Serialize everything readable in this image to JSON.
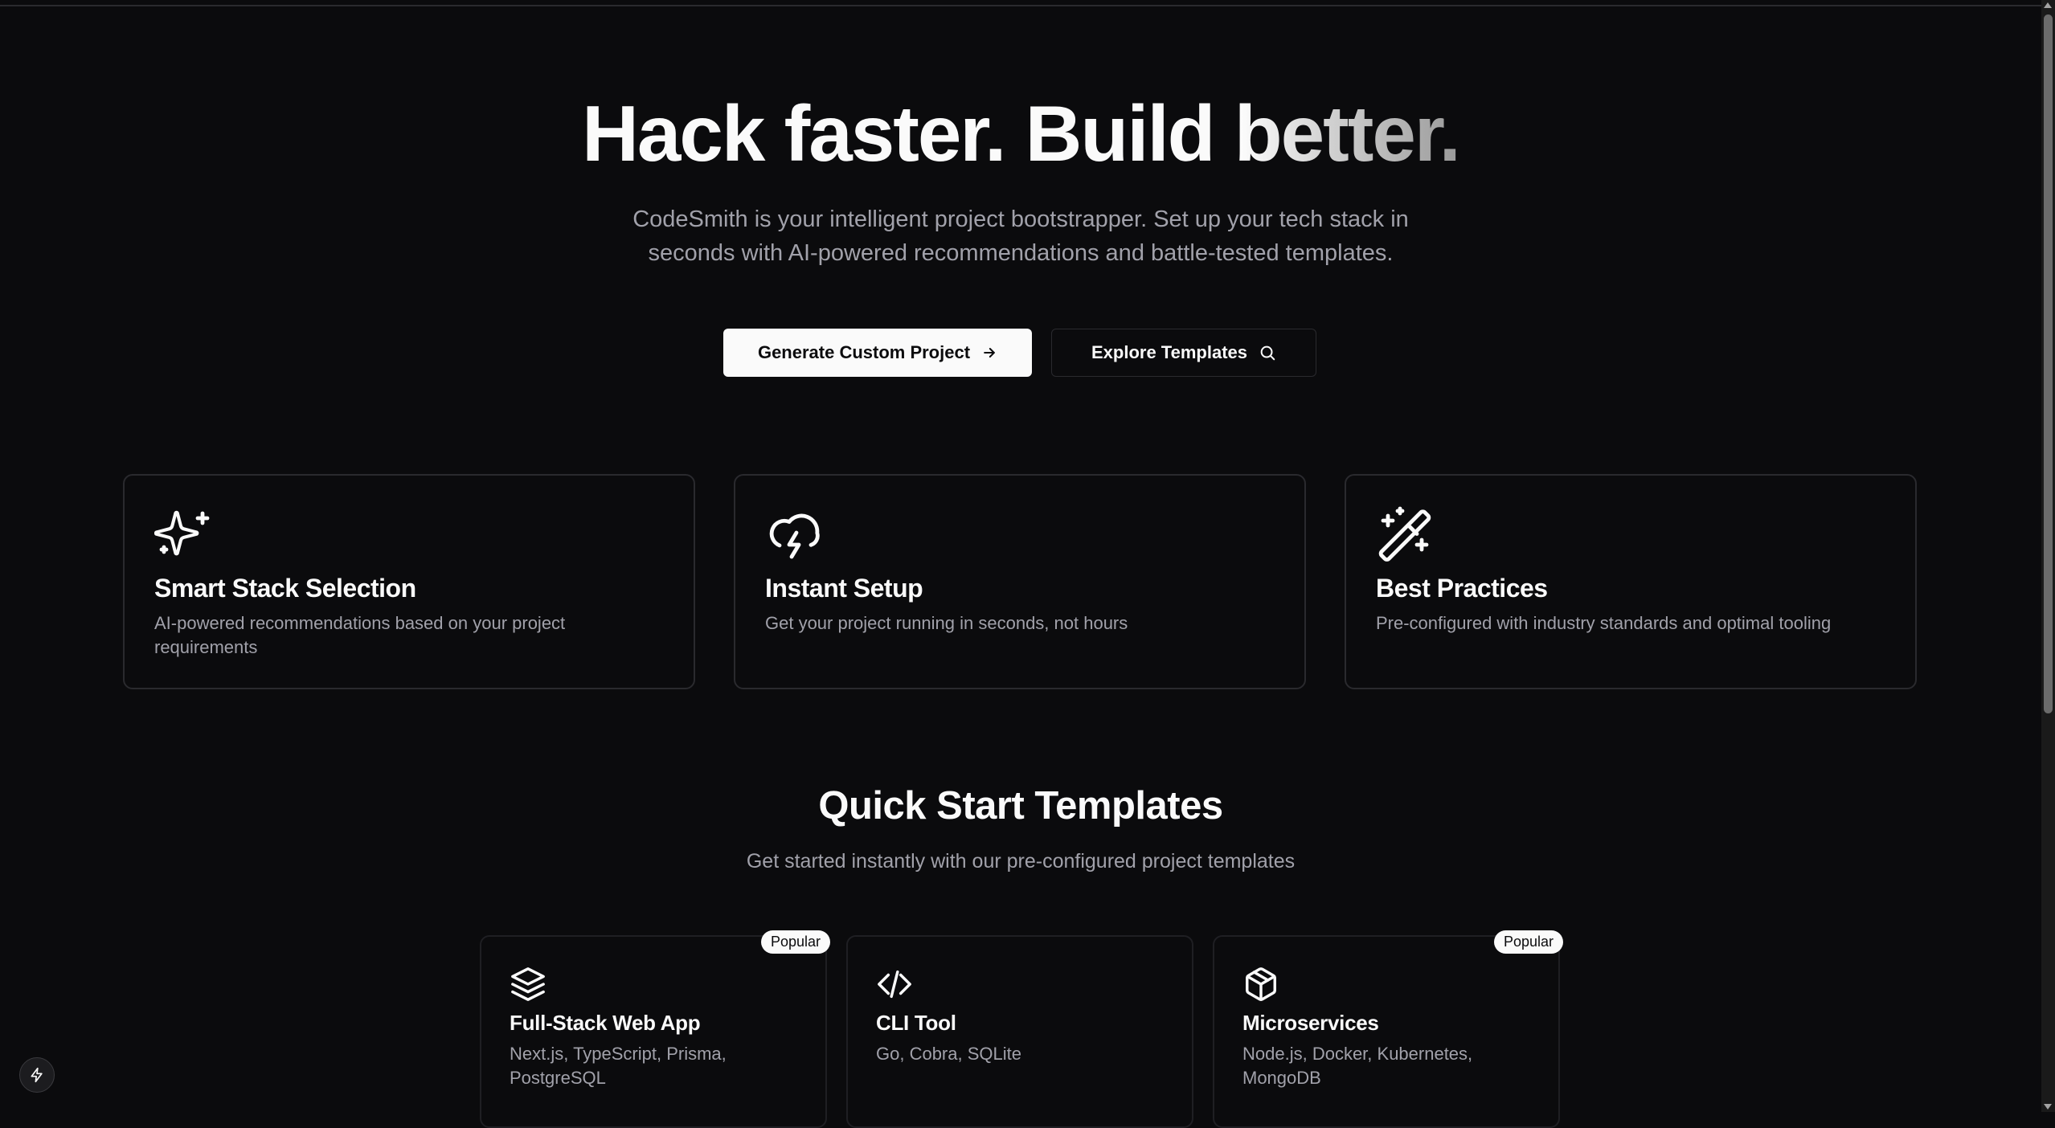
{
  "hero": {
    "title_part1": "Hack faster. Build ",
    "title_accent": "better.",
    "subtitle": "CodeSmith is your intelligent project bootstrapper. Set up your tech stack in seconds with AI-powered recommendations and battle-tested templates."
  },
  "actions": {
    "primary_label": "Generate Custom Project",
    "primary_icon": "arrow-right-icon",
    "secondary_label": "Explore Templates",
    "secondary_icon": "search-icon"
  },
  "features": [
    {
      "icon": "sparkles-icon",
      "title": "Smart Stack Selection",
      "description": "AI-powered recommendations based on your project requirements"
    },
    {
      "icon": "cloud-lightning-icon",
      "title": "Instant Setup",
      "description": "Get your project running in seconds, not hours"
    },
    {
      "icon": "magic-wand-icon",
      "title": "Best Practices",
      "description": "Pre-configured with industry standards and optimal tooling"
    }
  ],
  "templates_section": {
    "title": "Quick Start Templates",
    "subtitle": "Get started instantly with our pre-configured project templates"
  },
  "templates": [
    {
      "icon": "layers-icon",
      "title": "Full-Stack Web App",
      "stack": "Next.js, TypeScript, Prisma, PostgreSQL",
      "badge": "Popular"
    },
    {
      "icon": "code-icon",
      "title": "CLI Tool",
      "stack": "Go, Cobra, SQLite",
      "badge": ""
    },
    {
      "icon": "package-icon",
      "title": "Microservices",
      "stack": "Node.js, Docker, Kubernetes, MongoDB",
      "badge": "Popular"
    }
  ],
  "dev_indicator": {
    "icon": "lightning-bolt-icon"
  },
  "colors": {
    "background": "#0b0b0d",
    "foreground": "#fafafa",
    "muted": "#a1a1aa",
    "border": "#2a2a2e"
  }
}
